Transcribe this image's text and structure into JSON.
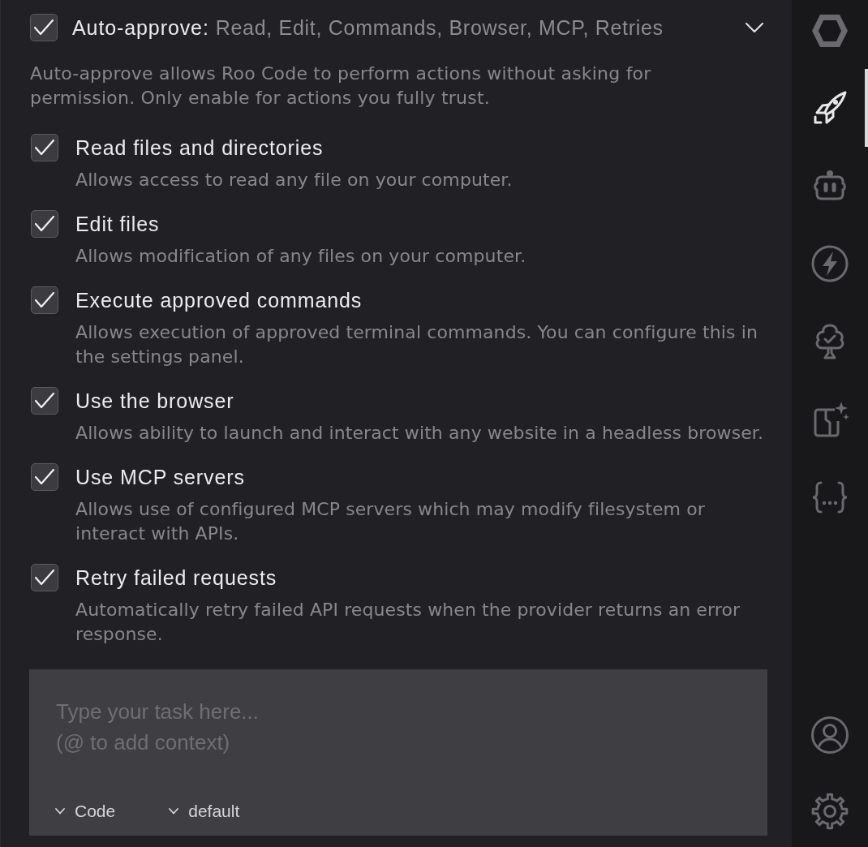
{
  "header": {
    "checked": true,
    "label": "Auto-approve:",
    "summary": "Read, Edit, Commands, Browser, MCP, Retries",
    "expanded": true
  },
  "description": "Auto-approve allows Roo Code to perform actions without asking for permission. Only enable for actions you fully trust.",
  "options": [
    {
      "label": "Read files and directories",
      "description": "Allows access to read any file on your computer.",
      "checked": true
    },
    {
      "label": "Edit files",
      "description": "Allows modification of any files on your computer.",
      "checked": true
    },
    {
      "label": "Execute approved commands",
      "description": "Allows execution of approved terminal commands. You can configure this in the settings panel.",
      "checked": true
    },
    {
      "label": "Use the browser",
      "description": "Allows ability to launch and interact with any website in a headless browser.",
      "checked": true
    },
    {
      "label": "Use MCP servers",
      "description": "Allows use of configured MCP servers which may modify filesystem or interact with APIs.",
      "checked": true
    },
    {
      "label": "Retry failed requests",
      "description": "Automatically retry failed API requests when the provider returns an error response.",
      "checked": true
    }
  ],
  "task_input": {
    "placeholder": "Type your task here...\n(@ to add context)",
    "selectors": [
      {
        "label": "Code"
      },
      {
        "label": "default"
      }
    ]
  },
  "sidebar": {
    "top_items": [
      {
        "kind": "logo",
        "selected": false
      },
      {
        "kind": "rocket",
        "selected": true
      },
      {
        "kind": "robot",
        "selected": false
      },
      {
        "kind": "bolt",
        "selected": false
      },
      {
        "kind": "tree",
        "selected": false
      },
      {
        "kind": "document",
        "selected": false
      },
      {
        "kind": "braces",
        "selected": false
      }
    ],
    "bottom_items": [
      {
        "kind": "account",
        "selected": false
      },
      {
        "kind": "settings",
        "selected": false
      }
    ]
  }
}
